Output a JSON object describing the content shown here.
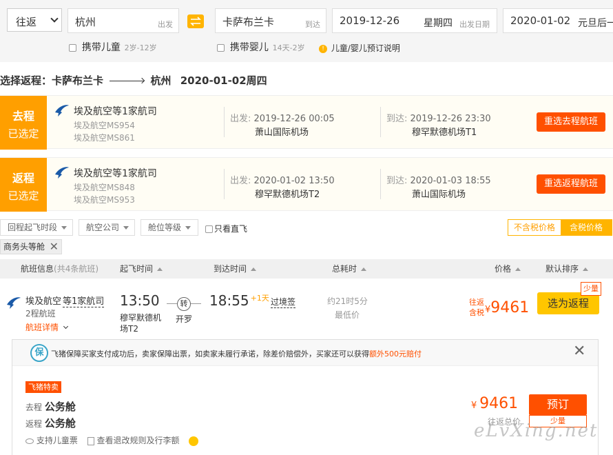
{
  "search": {
    "trip_type": "往返",
    "from_city": "杭州",
    "from_suffix": "出发",
    "to_city": "卡萨布兰卡",
    "to_suffix": "到达",
    "depart_date": "2019-12-26",
    "depart_weekday": "星期四",
    "depart_suffix": "出发日期",
    "return_date": "2020-01-02",
    "return_weekday": "元旦后一",
    "child_label": "携带儿童",
    "child_age": "2岁-12岁",
    "infant_label": "携带婴儿",
    "infant_age": "14天-2岁",
    "booking_note": "儿童/婴儿预订说明"
  },
  "selection_title": {
    "prefix": "选择返程：卡萨布兰卡",
    "to": "杭州",
    "date": "2020-01-02周四"
  },
  "selected": [
    {
      "tag_top": "去程",
      "tag_bottom": "已选定",
      "airline": "埃及航空等1家航司",
      "flights": [
        "埃及航空MS954",
        "埃及航空MS861"
      ],
      "depart_label": "出发:",
      "depart_time": "2019-12-26 00:05",
      "depart_airport": "萧山国际机场",
      "arrive_label": "到达:",
      "arrive_time": "2019-12-26 23:30",
      "arrive_airport": "穆罕默德机场T1",
      "rechoose": "重选去程航班"
    },
    {
      "tag_top": "返程",
      "tag_bottom": "已选定",
      "airline": "埃及航空等1家航司",
      "flights": [
        "埃及航空MS848",
        "埃及航空MS953"
      ],
      "depart_label": "出发:",
      "depart_time": "2020-01-02 13:50",
      "depart_airport": "穆罕默德机场T2",
      "arrive_label": "到达:",
      "arrive_time": "2020-01-03 18:55",
      "arrive_airport": "萧山国际机场",
      "rechoose": "重选返程航班"
    }
  ],
  "filters": {
    "return_time": "回程起飞时段",
    "airline": "航空公司",
    "cabin": "舱位等级",
    "direct_only": "只看直飞",
    "price_excl_tax": "不含税价格",
    "price_incl_tax": "含税价格",
    "active_tag": "商务头等舱"
  },
  "table_header": {
    "flight_info": "航班信息",
    "count": "(共4条航班)",
    "depart": "起飞时间",
    "arrive": "到达时间",
    "duration": "总耗时",
    "price": "价格",
    "sort": "默认排序"
  },
  "result": {
    "airline": "埃及航空",
    "airline_more": "等1家航司",
    "legs": "2程航班",
    "details": "航班详情",
    "depart_time": "13:50",
    "depart_airport_1": "穆罕默德机",
    "depart_airport_2": "场T2",
    "transfer_icon": "转",
    "transfer_city": "开罗",
    "arrive_time": "18:55",
    "day_offset": "+1天",
    "visa": "过境签",
    "duration": "约21时5分",
    "duration_note": "最低价",
    "price_label_1": "往返",
    "price_label_2": "含税",
    "currency": "¥",
    "price": "9461",
    "select_btn": "选为返程",
    "scarcity": "少量"
  },
  "panel": {
    "guarantee_icon": "保",
    "guarantee_text": "飞猪保障买家支付成功后，卖家保障出票，如卖家未履行承诺，除差价赔偿外，买家还可以获得",
    "guarantee_highlight": "额外500元赔付",
    "badge": "飞猪特卖",
    "outbound_label": "去程",
    "outbound_cabin": "公务舱",
    "return_label": "返程",
    "return_cabin": "公务舱",
    "child_support": "支持儿童票",
    "rules": "查看退改规则及行李额",
    "currency": "¥",
    "price": "9461",
    "price_note": "往返总价",
    "book_btn": "预订",
    "book_scarcity": "少量"
  },
  "watermark": "eLvXing.net",
  "colors": {
    "accent": "#ff5000",
    "tag": "#ff9f00",
    "yellow_btn": "#ffc600"
  }
}
